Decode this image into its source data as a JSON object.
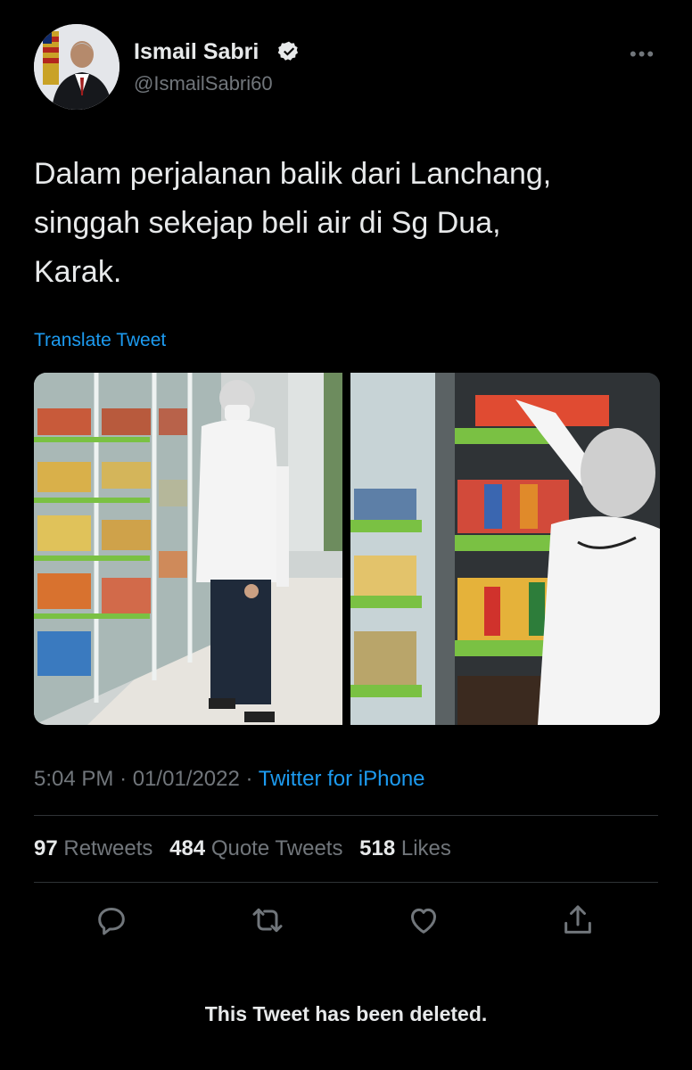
{
  "author": {
    "display_name": "Ismail Sabri",
    "handle": "@IsmailSabri60"
  },
  "more_icon": "more-horizontal-icon",
  "tweet": {
    "text_lines": [
      "Dalam perjalanan balik dari Lanchang,",
      "singgah sekejap beli air di Sg Dua,",
      "Karak."
    ],
    "translate_label": "Translate Tweet"
  },
  "meta": {
    "time": "5:04 PM",
    "date": "01/01/2022",
    "separator": "·",
    "source": "Twitter for iPhone"
  },
  "stats": {
    "retweets_count": "97",
    "retweets_label": "Retweets",
    "quotes_count": "484",
    "quotes_label": "Quote Tweets",
    "likes_count": "518",
    "likes_label": "Likes"
  },
  "actions": [
    "reply-icon",
    "retweet-icon",
    "like-icon",
    "share-icon"
  ],
  "status_message": "This Tweet has been deleted.",
  "colors": {
    "background": "#000000",
    "accent": "#1d9bf0",
    "secondary_text": "#71767b",
    "primary_text": "#e7e9ea"
  }
}
